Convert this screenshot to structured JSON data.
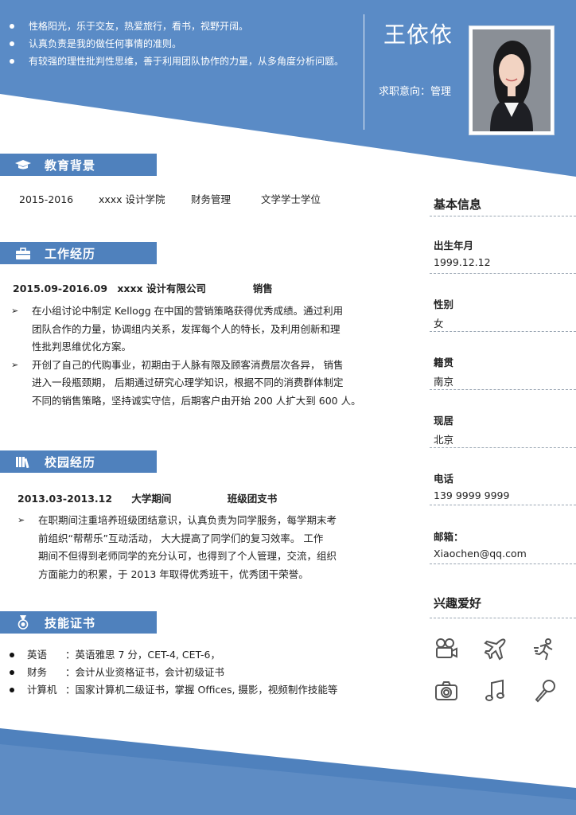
{
  "header": {
    "intro": [
      "性格阳光，乐于交友，热爱旅行，看书，视野开阔。",
      "认真负责是我的做任何事情的准则。",
      "有较强的理性批判性思维，善于利用团队协作的力量，从多角度分析问题。"
    ],
    "name": "王依依",
    "intent": "求职意向：管理"
  },
  "education": {
    "title": "教育背景",
    "icon": "graduation-cap-icon",
    "years": "2015-2016",
    "school": "xxxx 设计学院",
    "major": "财务管理",
    "degree": "文学学士学位"
  },
  "work": {
    "title": "工作经历",
    "icon": "briefcase-icon",
    "period": "2015.09-2016.09",
    "company": "xxxx 设计有限公司",
    "role": "销售",
    "bullets": [
      [
        "在小组讨论中制定 Kellogg 在中国的营销策略获得优秀成绩。通过利用",
        "团队合作的力量，协调组内关系，发挥每个人的特长，及利用创新和理",
        "性批判思维优化方案。"
      ],
      [
        "开创了自己的代购事业，初期由于人脉有限及顾客消费层次各异， 销售",
        "进入一段瓶颈期， 后期通过研究心理学知识，根据不同的消费群体制定",
        "不同的销售策略，坚持诚实守信，后期客户由开始 200 人扩大到 600 人。"
      ]
    ]
  },
  "campus": {
    "title": "校园经历",
    "icon": "books-icon",
    "period": "2013.03-2013.12",
    "org": "大学期间",
    "role": "班级团支书",
    "bullets": [
      [
        "在职期间注重培养班级团结意识，认真负责为同学服务，每学期末考",
        "前组织“帮帮乐”互动活动， 大大提高了同学们的复习效率。 工作",
        "期间不但得到老师同学的充分认可，也得到了个人管理，交流，组织",
        "方面能力的积累，于 2013 年取得优秀班干，优秀团干荣誉。"
      ]
    ]
  },
  "skills": {
    "title": "技能证书",
    "icon": "medal-icon",
    "items": [
      {
        "label": "英语",
        "text": "：英语雅思 7 分，CET-4, CET-6，"
      },
      {
        "label": "财务",
        "text": "：会计从业资格证书，会计初级证书"
      },
      {
        "label": "计算机",
        "text": "：国家计算机二级证书，掌握 Offices, 摄影，视频制作技能等"
      }
    ]
  },
  "basic_info": {
    "title": "基本信息",
    "fields": [
      {
        "label": "出生年月",
        "value": "1999.12.12"
      },
      {
        "label": "性别",
        "value": "女"
      },
      {
        "label": "籍贯",
        "value": "南京"
      },
      {
        "label": "现居",
        "value": "北京"
      },
      {
        "label": "电话",
        "value": "139 9999 9999"
      },
      {
        "label": "邮箱：",
        "value": "Xiaochen@qq.com"
      }
    ]
  },
  "hobbies": {
    "title": "兴趣爱好",
    "icons": [
      "film-camera-icon",
      "airplane-icon",
      "running-icon",
      "camera-icon",
      "music-note-icon",
      "microphone-icon"
    ]
  },
  "colors": {
    "accent": "#4f81bd",
    "header_bg": "#5a8bc6",
    "footer_bg": "#4f81bd"
  }
}
